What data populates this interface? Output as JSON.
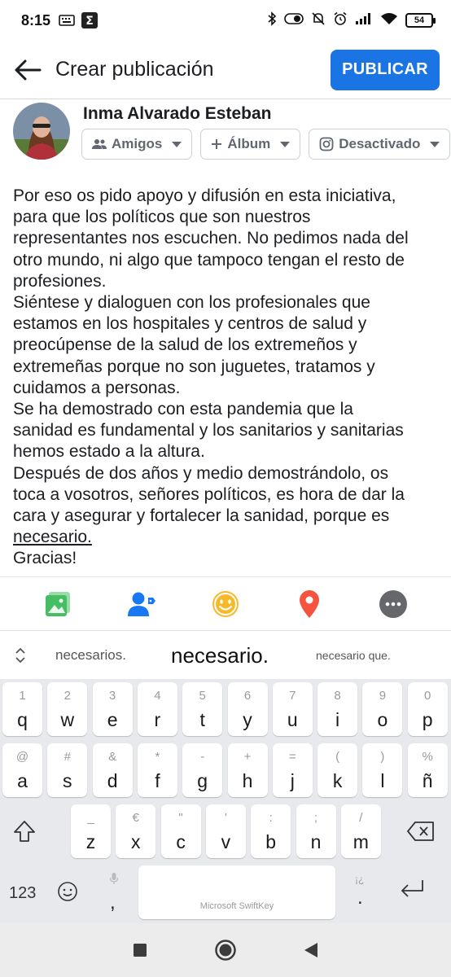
{
  "status_bar": {
    "time": "8:15",
    "icons_left": [
      "keyboard-icon",
      "sigma-app-icon"
    ],
    "icons_right": [
      "bluetooth-icon",
      "toggle-icon",
      "muted-bell-icon",
      "alarm-icon",
      "signal-icon",
      "wifi-icon"
    ],
    "battery": "54"
  },
  "app_bar": {
    "title": "Crear publicación",
    "publish_label": "PUBLICAR"
  },
  "author": {
    "name": "Inma Alvarado Esteban",
    "audience_label": "Amigos",
    "album_label": "Álbum",
    "instagram_label": "Desactivado"
  },
  "post": {
    "line1": "Por eso os pido apoyo y difusión en esta iniciativa,",
    "line2": "para que los políticos que son nuestros",
    "line3": "representantes nos escuchen. No pedimos nada del",
    "line4": "otro mundo, ni algo que tampoco tengan el resto de",
    "line5": "profesiones.",
    "line6": "Siéntese y dialoguen con los profesionales que",
    "line7": "estamos en los hospitales y centros de salud y",
    "line8": "preocúpense de la salud de los extremeños y",
    "line9": "extremeñas porque no son juguetes, tratamos y",
    "line10": "cuidamos a personas.",
    "line11": "Se ha demostrado con esta pandemia que la",
    "line12": "sanidad es fundamental y los sanitarios y sanitarias",
    "line13": "hemos estado a la altura.",
    "line14": "Después de dos años y medio demostrándolo, os",
    "line15": "toca a vosotros, señores políticos, es hora de dar la",
    "line16": "cara y asegurar y fortalecer la sanidad, porque es",
    "line17": "necesario.",
    "line18": "Gracias!"
  },
  "attachments": [
    "photo-icon",
    "tag-people-icon",
    "feeling-icon",
    "location-icon",
    "more-icon"
  ],
  "colors": {
    "accent": "#1b74e4",
    "photo": "#45bd62",
    "tag": "#1877f2",
    "feeling": "#f7b928",
    "location": "#f5533d",
    "more": "#65676b"
  },
  "suggestions": {
    "left": "necesarios.",
    "center": "necesario.",
    "right": "necesario que."
  },
  "keyboard": {
    "row1": [
      {
        "p": "q",
        "s": "1"
      },
      {
        "p": "w",
        "s": "2"
      },
      {
        "p": "e",
        "s": "3"
      },
      {
        "p": "r",
        "s": "4"
      },
      {
        "p": "t",
        "s": "5"
      },
      {
        "p": "y",
        "s": "6"
      },
      {
        "p": "u",
        "s": "7"
      },
      {
        "p": "i",
        "s": "8"
      },
      {
        "p": "o",
        "s": "9"
      },
      {
        "p": "p",
        "s": "0"
      }
    ],
    "row2": [
      {
        "p": "a",
        "s": "@"
      },
      {
        "p": "s",
        "s": "#"
      },
      {
        "p": "d",
        "s": "&"
      },
      {
        "p": "f",
        "s": "*"
      },
      {
        "p": "g",
        "s": "-"
      },
      {
        "p": "h",
        "s": "+"
      },
      {
        "p": "j",
        "s": "="
      },
      {
        "p": "k",
        "s": "("
      },
      {
        "p": "l",
        "s": ")"
      },
      {
        "p": "ñ",
        "s": "%"
      }
    ],
    "row3": [
      {
        "p": "z",
        "s": "_"
      },
      {
        "p": "x",
        "s": "€"
      },
      {
        "p": "c",
        "s": "\""
      },
      {
        "p": "v",
        "s": "'"
      },
      {
        "p": "b",
        "s": ":"
      },
      {
        "p": "n",
        "s": ";"
      },
      {
        "p": "m",
        "s": "/"
      }
    ],
    "numbers_label": "123",
    "comma": ",",
    "period": ".",
    "period_alt": "¡¿",
    "space_brand": "Microsoft SwiftKey"
  }
}
